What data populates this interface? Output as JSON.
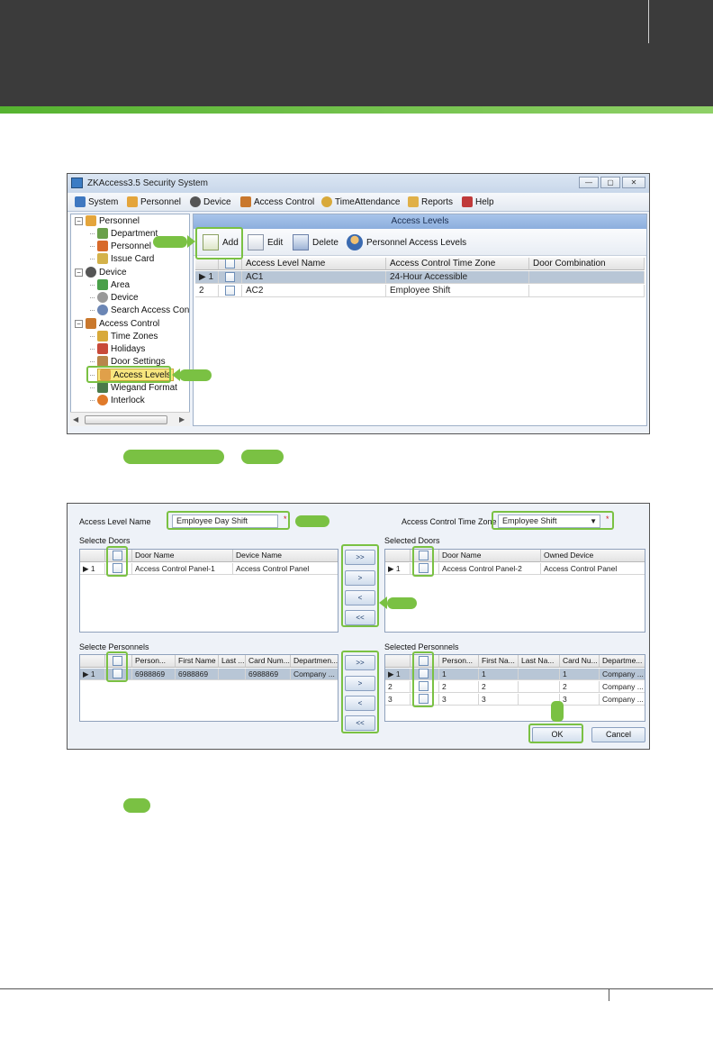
{
  "app": {
    "title": "ZKAccess3.5 Security System",
    "window_buttons": [
      "—",
      "▢",
      "✕"
    ],
    "menu": [
      "System",
      "Personnel",
      "Device",
      "Access Control",
      "TimeAttendance",
      "Reports",
      "Help"
    ]
  },
  "tree": {
    "personnel": "Personnel",
    "department": "Department",
    "personnel_child": "Personnel",
    "issue_card": "Issue Card",
    "device": "Device",
    "area": "Area",
    "device_child": "Device",
    "search_access": "Search Access Cont",
    "access_control": "Access Control",
    "time_zones": "Time Zones",
    "holidays": "Holidays",
    "door_settings": "Door Settings",
    "access_levels": "Access Levels",
    "wiegand_format": "Wiegand Format",
    "interlock": "Interlock",
    "expander_minus": "−"
  },
  "panel": {
    "title": "Access Levels",
    "toolbar": {
      "add": "Add",
      "edit": "Edit",
      "delete": "Delete",
      "personnel_access": "Personnel Access Levels"
    },
    "columns": [
      "Access Level Name",
      "Access Control Time Zone",
      "Door Combination"
    ],
    "rows": [
      {
        "num": "1",
        "name": "AC1",
        "zone": "24-Hour Accessible",
        "combo": "",
        "selected": true
      },
      {
        "num": "2",
        "name": "AC2",
        "zone": "Employee Shift",
        "combo": "",
        "selected": false
      }
    ]
  },
  "dialog": {
    "access_level_name_label": "Access Level Name",
    "access_level_name_value": "Employee Day Shift",
    "time_zone_label": "Access Control Time Zone",
    "time_zone_value": "Employee Shift",
    "required_mark": "*",
    "select_doors_label": "Selecte Doors",
    "selected_doors_label": "Selected Doors",
    "select_personnel_label": "Selecte Personnels",
    "selected_personnel_label": "Selected Personnels",
    "doors_left_cols": [
      "Door Name",
      "Device Name"
    ],
    "doors_left_rows": [
      {
        "num": "1",
        "door": "Access Control Panel-1",
        "device": "Access Control Panel"
      }
    ],
    "doors_right_cols": [
      "Door Name",
      "Owned Device"
    ],
    "doors_right_rows": [
      {
        "num": "1",
        "door": "Access Control Panel-2",
        "device": "Access Control Panel"
      }
    ],
    "pers_left_cols": [
      "Person...",
      "First Name",
      "Last ...",
      "Card Num...",
      "Departmen..."
    ],
    "pers_left_rows": [
      {
        "num": "1",
        "pin": "6988869",
        "first": "6988869",
        "last": "",
        "card": "6988869",
        "dept": "Company ..."
      }
    ],
    "pers_right_cols": [
      "Person...",
      "First Na...",
      "Last Na...",
      "Card Nu...",
      "Departme..."
    ],
    "pers_right_rows": [
      {
        "num": "1",
        "pin": "1",
        "first": "1",
        "last": "",
        "card": "1",
        "dept": "Company ..."
      },
      {
        "num": "2",
        "pin": "2",
        "first": "2",
        "last": "",
        "card": "2",
        "dept": "Company ..."
      },
      {
        "num": "3",
        "pin": "3",
        "first": "3",
        "last": "",
        "card": "3",
        "dept": "Company ..."
      }
    ],
    "move_buttons": [
      ">>",
      ">",
      "<",
      "<<"
    ],
    "ok": "OK",
    "cancel": "Cancel",
    "row_marker": "▶"
  },
  "colors": {
    "accent_green": "#7ac143",
    "header_dark": "#3b3b3b"
  }
}
